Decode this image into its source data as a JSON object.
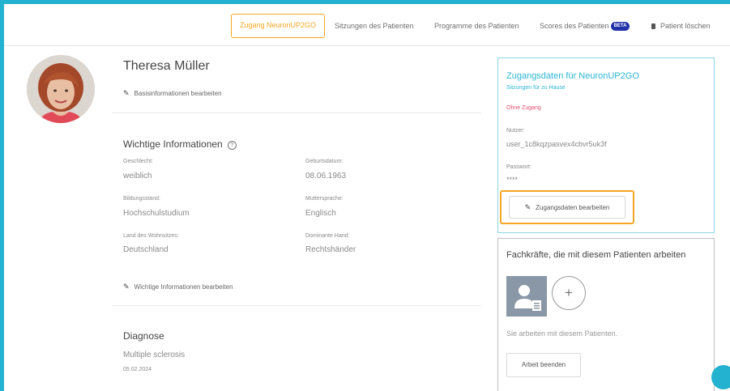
{
  "nav": {
    "access": "Zugang NeuronUP2GO",
    "sessions": "Sitzungen des Patienten",
    "programs": "Programme des Patienten",
    "scores": "Scores des Patienten",
    "beta": "BETA",
    "delete": "Patient löschen"
  },
  "patient": {
    "name": "Theresa Müller",
    "edit_basic": "Basisinformationen bearbeiten"
  },
  "important": {
    "title": "Wichtige Informationen",
    "help_glyph": "?",
    "fields": [
      {
        "label": "Geschlecht:",
        "value": "weiblich"
      },
      {
        "label": "Geburtsdatum:",
        "value": "08.06.1963"
      },
      {
        "label": "Bildungsstand:",
        "value": "Hochschulstudium"
      },
      {
        "label": "Muttersprache:",
        "value": "Englisch"
      },
      {
        "label": "Land des Wohnsitzes:",
        "value": "Deutschland"
      },
      {
        "label": "Dominante Hand:",
        "value": "Rechtshänder"
      }
    ],
    "edit": "Wichtige Informationen bearbeiten"
  },
  "diagnosis": {
    "title": "Diagnose",
    "text": "Multiple sclerosis",
    "date": "05.02.2024"
  },
  "access_card": {
    "title": "Zugangsdaten für NeuronUP2GO",
    "subtitle": "Sitzungen für zu Hause",
    "status": "Ohne Zugang",
    "user_label": "Nutzer:",
    "user_value": "user_1c8kqzpasvex4cbvr5uk3f",
    "password_label": "Passwort:",
    "password_value": "****",
    "edit_button": "Zugangsdaten bearbeiten"
  },
  "pros_card": {
    "title": "Fachkräfte, die mit diesem Patienten arbeiten",
    "add_glyph": "+",
    "note": "Sie arbeiten mit diesem Patienten.",
    "end_button": "Arbeit beenden"
  },
  "icons": [
    "pencil-icon",
    "help-icon",
    "trash-icon",
    "plus-icon",
    "user-icon",
    "chat-icon"
  ],
  "colors": {
    "accent": "#23b2cf",
    "highlight": "#f5a623",
    "warning": "#e74c6f",
    "beta": "#2233aa"
  }
}
